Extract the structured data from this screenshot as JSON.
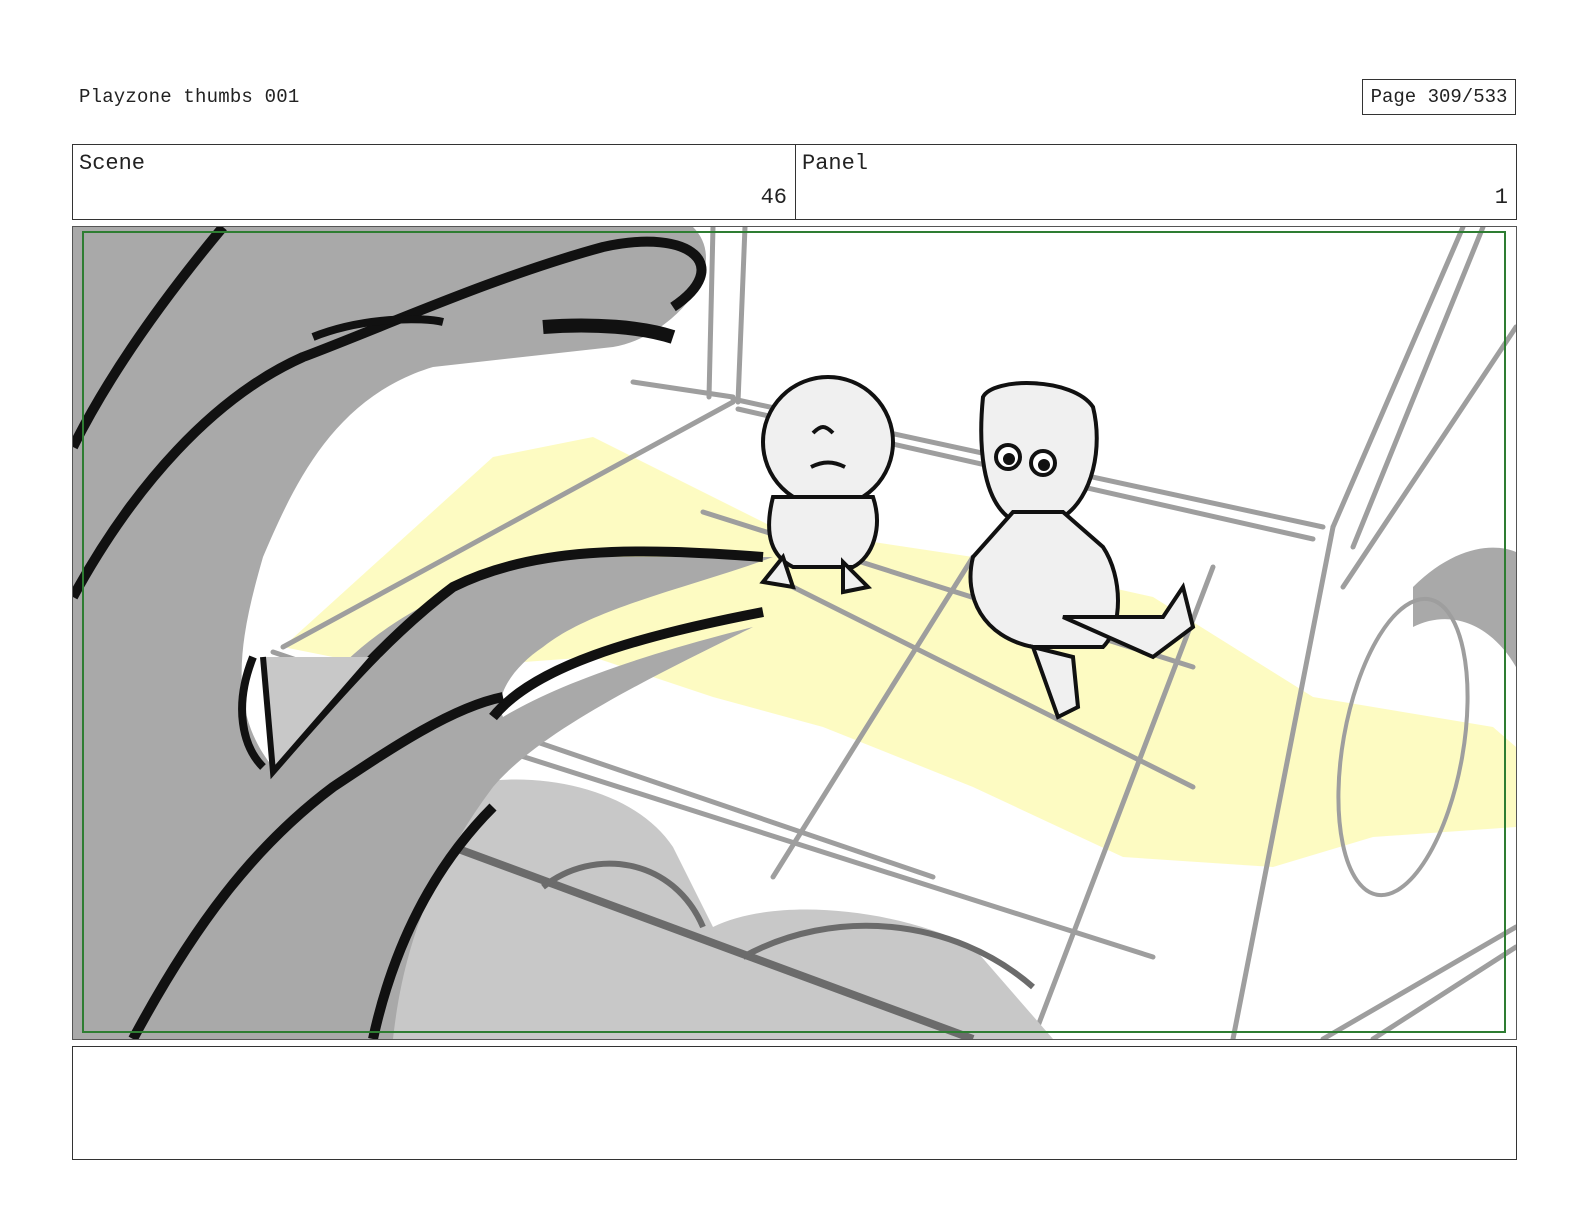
{
  "header": {
    "title": "Playzone thumbs 001",
    "page_label": "Page 309/533"
  },
  "scene": {
    "label": "Scene",
    "value": "46"
  },
  "panel": {
    "label": "Panel",
    "value": "1"
  },
  "notes": {
    "text": ""
  },
  "colors": {
    "safe_frame": "#2e7d32",
    "light_beam": "#fdfbbf",
    "hand": "#a9a9a9",
    "line_gray": "#9e9e9e"
  },
  "icons": {
    "artwork": "storyboard-drawing"
  }
}
